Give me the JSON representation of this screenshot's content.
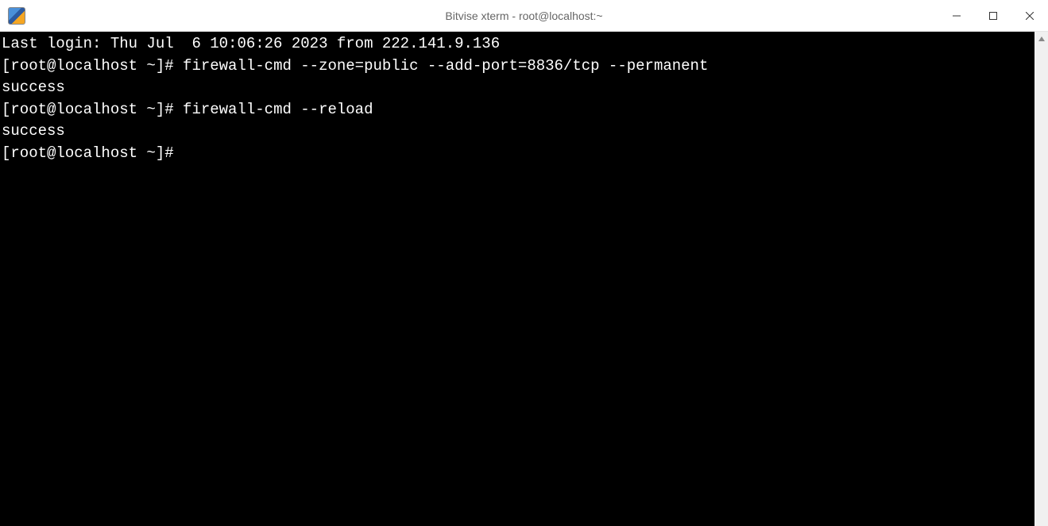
{
  "window": {
    "title": "Bitvise xterm - root@localhost:~"
  },
  "terminal": {
    "lines": [
      {
        "type": "text",
        "content": "Last login: Thu Jul  6 10:06:26 2023 from 222.141.9.136"
      },
      {
        "type": "prompt",
        "prompt": "[root@localhost ~]# ",
        "command": "firewall-cmd --zone=public --add-port=8836/tcp --permanent"
      },
      {
        "type": "text",
        "content": "success"
      },
      {
        "type": "prompt",
        "prompt": "[root@localhost ~]# ",
        "command": "firewall-cmd --reload"
      },
      {
        "type": "text",
        "content": "success"
      },
      {
        "type": "prompt",
        "prompt": "[root@localhost ~]# ",
        "command": ""
      }
    ]
  }
}
